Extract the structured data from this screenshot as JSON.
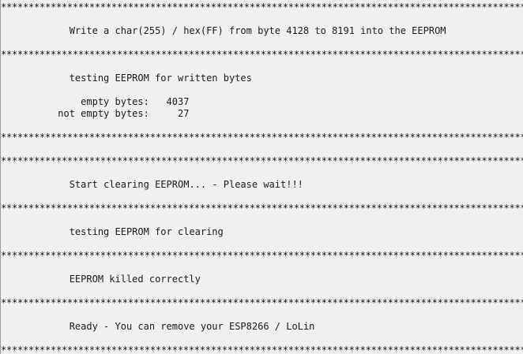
{
  "console": {
    "lines": [
      "*****************************************************************************************************",
      "            Write a char(255) / hex(FF) from byte 4128 to 8191 into the EEPROM",
      "*****************************************************************************************************",
      "            testing EEPROM for written bytes",
      "              empty bytes:   4037",
      "          not empty bytes:     27",
      "*****************************************************************************************************",
      "*****************************************************************************************************",
      "            Start clearing EEPROM... - Please wait!!!",
      "*****************************************************************************************************",
      "            testing EEPROM for clearing",
      "*****************************************************************************************************",
      "            EEPROM killed correctly",
      "*****************************************************************************************************",
      "            Ready - You can remove your ESP8266 / LoLin",
      "*****************************************************************************************************"
    ]
  }
}
